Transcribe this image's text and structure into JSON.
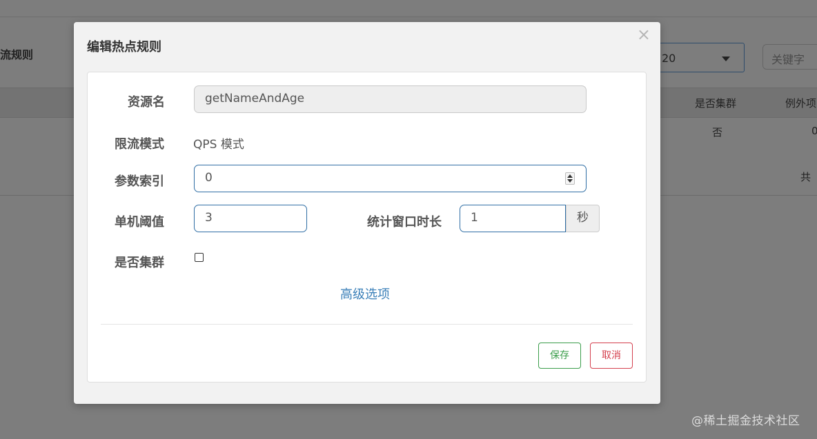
{
  "background": {
    "title": "流规则",
    "page_size_value": "20",
    "search_placeholder": "关键字",
    "columns": [
      "是否集群",
      "例外项"
    ],
    "row": {
      "cluster": "否",
      "exceptions": "0"
    },
    "total_label": "共"
  },
  "modal": {
    "title": "编辑热点规则",
    "close_symbol": "×",
    "fields": {
      "resource_label": "资源名",
      "resource_value": "getNameAndAge",
      "mode_label": "限流模式",
      "mode_value": "QPS 模式",
      "param_index_label": "参数索引",
      "param_index_value": "0",
      "threshold_label": "单机阈值",
      "threshold_value": "3",
      "window_label": "统计窗口时长",
      "window_value": "1",
      "window_unit": "秒",
      "cluster_label": "是否集群",
      "cluster_checked": false
    },
    "advanced_link": "高级选项",
    "save_label": "保存",
    "cancel_label": "取消"
  },
  "watermark": "@稀土掘金技术社区",
  "colors": {
    "overlay": "#7d7d7d",
    "primary_border": "#2e6da4",
    "link": "#3a7fb8",
    "save": "#3a9d4a",
    "cancel": "#d43f4d"
  }
}
